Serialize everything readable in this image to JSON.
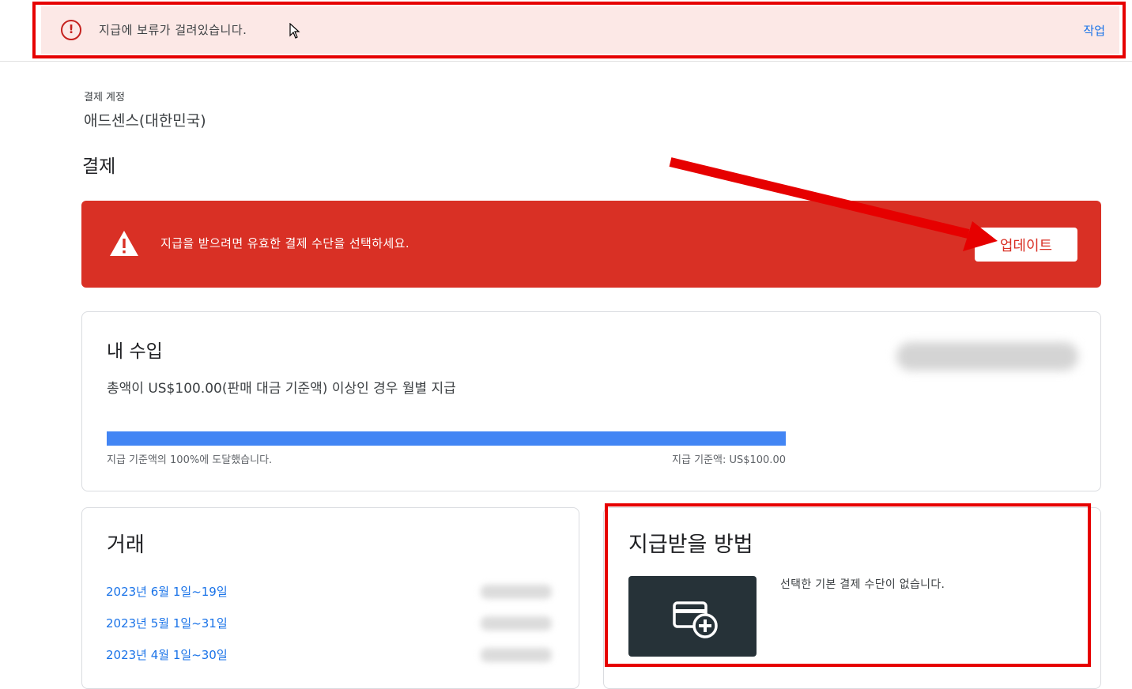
{
  "hold_banner": {
    "icon": "error-circle-icon",
    "message": "지급에 보류가 걸려있습니다.",
    "action_label": "작업",
    "accent_color": "#c5221f",
    "background": "#fce8e6"
  },
  "account": {
    "label": "결제 계정",
    "name": "애드센스(대한민국)"
  },
  "page": {
    "title": "결제"
  },
  "alert": {
    "icon": "warning-triangle-icon",
    "message": "지급을 받으려면 유효한 결제 수단을 선택하세요.",
    "button_label": "업데이트",
    "color": "#d93025"
  },
  "earnings": {
    "title": "내 수입",
    "description": "총액이 US$100.00(판매 대금 기준액) 이상인 경우 월별 지급",
    "progress_percent": 100,
    "progress_left_label": "지급 기준액의 100%에 도달했습니다.",
    "progress_right_label": "지급 기준액: US$100.00",
    "progress_color": "#4285f4"
  },
  "transactions": {
    "title": "거래",
    "items": [
      {
        "label": "2023년 6월 1일~19일"
      },
      {
        "label": "2023년 5월 1일~31일"
      },
      {
        "label": "2023년 4월 1일~30일"
      }
    ]
  },
  "payment_method": {
    "title": "지급받을 방법",
    "add_icon": "add-payment-card-icon",
    "empty_message": "선택한 기본 결제 수단이 없습니다."
  },
  "annotation_color": "#e60000"
}
